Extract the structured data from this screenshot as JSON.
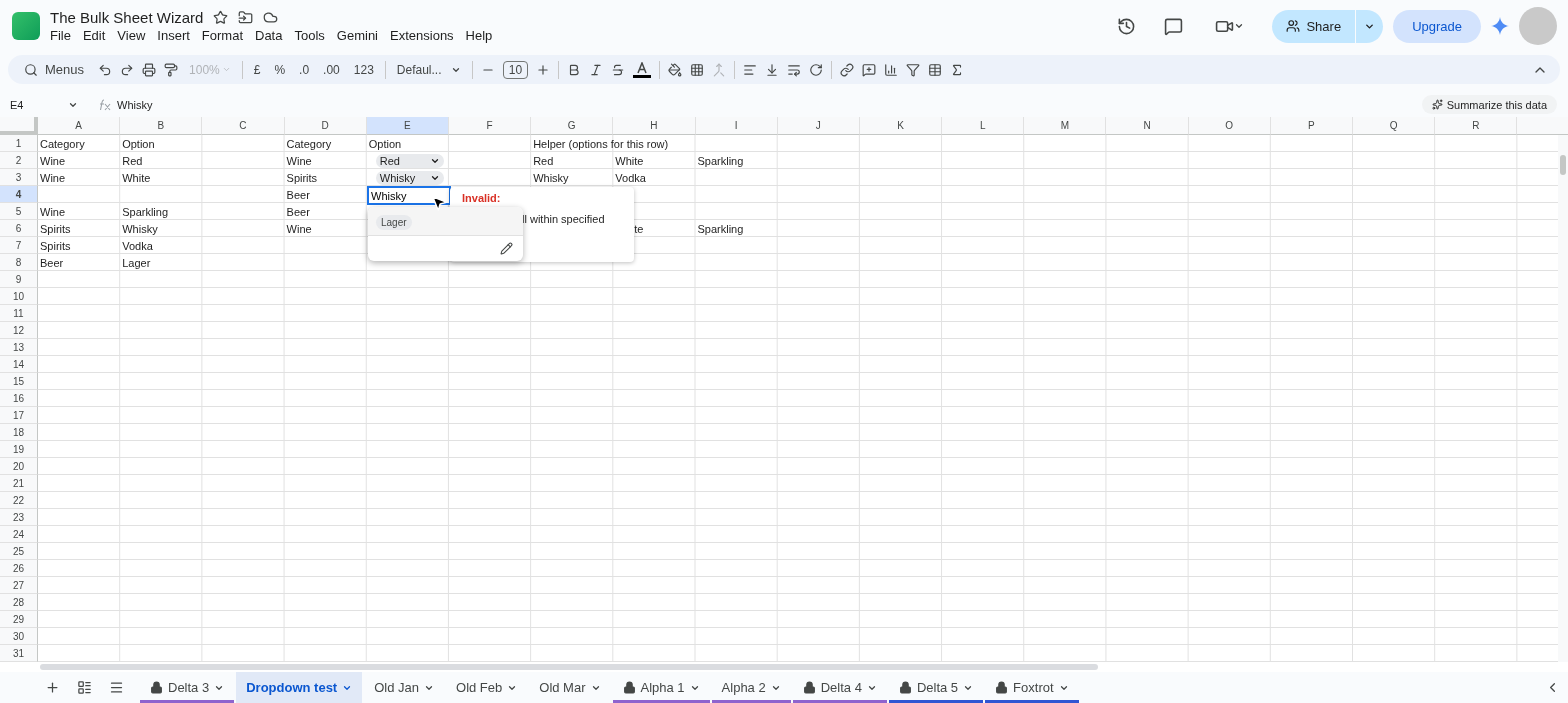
{
  "document": {
    "title": "The Bulk Sheet Wizard"
  },
  "menu": [
    "File",
    "Edit",
    "View",
    "Insert",
    "Format",
    "Data",
    "Tools",
    "Gemini",
    "Extensions",
    "Help"
  ],
  "header_buttons": {
    "share": "Share",
    "upgrade": "Upgrade"
  },
  "toolbar": {
    "search": "Menus",
    "zoom": "100%",
    "currency": "£",
    "percent": "%",
    "decrease_decimals": ".0",
    "increase_decimals": ".00",
    "number_format": "123",
    "font": "Defaul...",
    "font_size": "10"
  },
  "formula_bar": {
    "cell_ref": "E4",
    "value": "Whisky",
    "summarize": "Summarize this data"
  },
  "columns": [
    {
      "label": "A",
      "selected": false
    },
    {
      "label": "B",
      "selected": false
    },
    {
      "label": "C",
      "selected": false
    },
    {
      "label": "D",
      "selected": false
    },
    {
      "label": "E",
      "selected": true
    },
    {
      "label": "F",
      "selected": false
    },
    {
      "label": "G",
      "selected": false
    },
    {
      "label": "H",
      "selected": false
    },
    {
      "label": "I",
      "selected": false
    },
    {
      "label": "J",
      "selected": false
    },
    {
      "label": "K",
      "selected": false
    },
    {
      "label": "L",
      "selected": false
    },
    {
      "label": "M",
      "selected": false
    },
    {
      "label": "N",
      "selected": false
    },
    {
      "label": "O",
      "selected": false
    },
    {
      "label": "P",
      "selected": false
    },
    {
      "label": "Q",
      "selected": false
    },
    {
      "label": "R",
      "selected": false
    }
  ],
  "rows": [
    {
      "number": "1",
      "selected": false,
      "cells": {
        "A": {
          "kind": "text",
          "text": "Category"
        },
        "B": {
          "kind": "text",
          "text": "Option"
        },
        "D": {
          "kind": "text",
          "text": "Category"
        },
        "E": {
          "kind": "text",
          "text": "Option"
        },
        "G": {
          "kind": "text",
          "text": "Helper (options for this row)"
        }
      }
    },
    {
      "number": "2",
      "selected": false,
      "cells": {
        "A": {
          "kind": "text",
          "text": "Wine"
        },
        "B": {
          "kind": "text",
          "text": "Red"
        },
        "D": {
          "kind": "text",
          "text": "Wine"
        },
        "E": {
          "kind": "chip",
          "text": "Red"
        },
        "G": {
          "kind": "text",
          "text": "Red"
        },
        "H": {
          "kind": "text",
          "text": "White"
        },
        "I": {
          "kind": "text",
          "text": "Sparkling"
        }
      }
    },
    {
      "number": "3",
      "selected": false,
      "cells": {
        "A": {
          "kind": "text",
          "text": "Wine"
        },
        "B": {
          "kind": "text",
          "text": "White"
        },
        "D": {
          "kind": "text",
          "text": "Spirits"
        },
        "E": {
          "kind": "chip",
          "text": "Whisky"
        },
        "G": {
          "kind": "text",
          "text": "Whisky"
        },
        "H": {
          "kind": "text",
          "text": "Vodka"
        }
      }
    },
    {
      "number": "4",
      "selected": true,
      "cells": {
        "D": {
          "kind": "text",
          "text": "Beer"
        }
      }
    },
    {
      "number": "5",
      "selected": false,
      "cells": {
        "A": {
          "kind": "text",
          "text": "Wine"
        },
        "B": {
          "kind": "text",
          "text": "Sparkling"
        },
        "D": {
          "kind": "text",
          "text": "Beer"
        }
      }
    },
    {
      "number": "6",
      "selected": false,
      "cells": {
        "A": {
          "kind": "text",
          "text": "Spirits"
        },
        "B": {
          "kind": "text",
          "text": "Whisky"
        },
        "D": {
          "kind": "text",
          "text": "Wine"
        },
        "H": {
          "kind": "covered",
          "text": "te"
        },
        "I": {
          "kind": "text",
          "text": "Sparkling"
        }
      }
    },
    {
      "number": "7",
      "selected": false,
      "cells": {
        "A": {
          "kind": "text",
          "text": "Spirits"
        },
        "B": {
          "kind": "text",
          "text": "Vodka"
        }
      }
    },
    {
      "number": "8",
      "selected": false,
      "cells": {
        "A": {
          "kind": "text",
          "text": "Beer"
        },
        "B": {
          "kind": "text",
          "text": "Lager"
        }
      }
    },
    {
      "number": "9",
      "selected": false,
      "cells": {}
    },
    {
      "number": "10",
      "selected": false,
      "cells": {}
    },
    {
      "number": "11",
      "selected": false,
      "cells": {}
    },
    {
      "number": "12",
      "selected": false,
      "cells": {}
    },
    {
      "number": "13",
      "selected": false,
      "cells": {}
    },
    {
      "number": "14",
      "selected": false,
      "cells": {}
    },
    {
      "number": "15",
      "selected": false,
      "cells": {}
    },
    {
      "number": "16",
      "selected": false,
      "cells": {}
    },
    {
      "number": "17",
      "selected": false,
      "cells": {}
    },
    {
      "number": "18",
      "selected": false,
      "cells": {}
    },
    {
      "number": "19",
      "selected": false,
      "cells": {}
    },
    {
      "number": "20",
      "selected": false,
      "cells": {}
    },
    {
      "number": "21",
      "selected": false,
      "cells": {}
    },
    {
      "number": "22",
      "selected": false,
      "cells": {}
    },
    {
      "number": "23",
      "selected": false,
      "cells": {}
    },
    {
      "number": "24",
      "selected": false,
      "cells": {}
    },
    {
      "number": "25",
      "selected": false,
      "cells": {}
    },
    {
      "number": "26",
      "selected": false,
      "cells": {}
    },
    {
      "number": "27",
      "selected": false,
      "cells": {}
    },
    {
      "number": "28",
      "selected": false,
      "cells": {}
    },
    {
      "number": "29",
      "selected": false,
      "cells": {}
    },
    {
      "number": "30",
      "selected": false,
      "cells": {}
    },
    {
      "number": "31",
      "selected": false,
      "cells": {}
    }
  ],
  "editor": {
    "value": "Whisky"
  },
  "validation_popup": {
    "title": "Invalid:",
    "message": "ll within specified"
  },
  "dropdown": {
    "options": [
      "Lager"
    ]
  },
  "sheet_tabs": [
    {
      "label": "Delta 3",
      "locked": true,
      "selected": false,
      "color": "#8e63ce"
    },
    {
      "label": "Dropdown test",
      "locked": false,
      "selected": true
    },
    {
      "label": "Old Jan",
      "locked": false,
      "selected": false
    },
    {
      "label": "Old Feb",
      "locked": false,
      "selected": false
    },
    {
      "label": "Old Mar",
      "locked": false,
      "selected": false
    },
    {
      "label": "Alpha 1",
      "locked": true,
      "selected": false,
      "color": "#8e63ce"
    },
    {
      "label": "Alpha 2",
      "locked": false,
      "selected": false,
      "color": "#8e63ce"
    },
    {
      "label": "Delta 4",
      "locked": true,
      "selected": false,
      "color": "#8e63ce"
    },
    {
      "label": "Delta 5",
      "locked": true,
      "selected": false,
      "color": "#3056d3"
    },
    {
      "label": "Foxtrot",
      "locked": true,
      "selected": false,
      "color": "#3056d3"
    }
  ]
}
